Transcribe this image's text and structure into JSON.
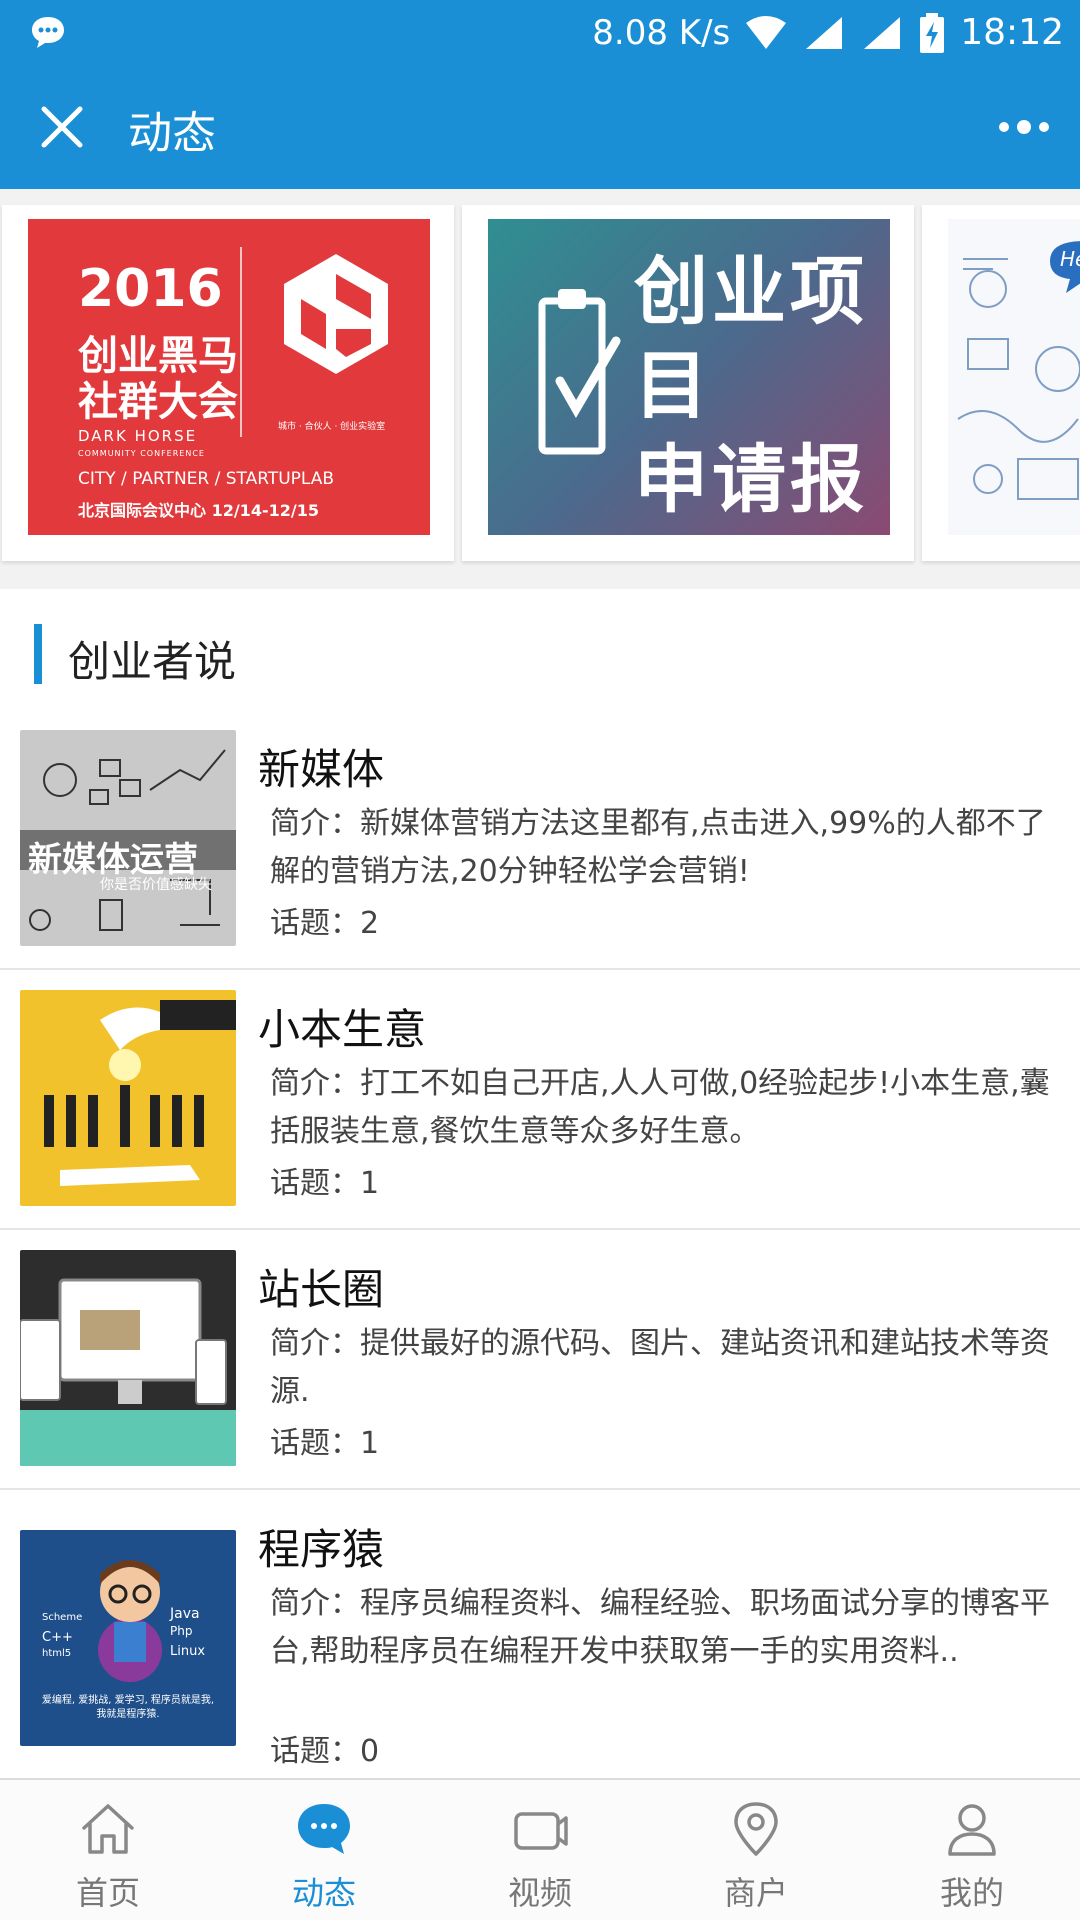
{
  "status_bar": {
    "speed": "8.08 K/s",
    "time": "18:12",
    "icons": [
      "chat-bubble-icon",
      "wifi-icon",
      "signal-icon",
      "signal-icon",
      "battery-charging-icon"
    ]
  },
  "app_bar": {
    "title": "动态",
    "close_icon": "close-icon",
    "more_icon": "more-icon"
  },
  "banners": [
    {
      "year": "2016",
      "line1": "创业黑马",
      "line2": "社群大会",
      "en": "DARK HORSE",
      "en_sub": "COMMUNITY CONFERENCE",
      "tagline": "CITY / PARTNER / STARTUPLAB",
      "venue": "北京国际会议中心  12/14-12/15",
      "logo_sub": "城市 · 合伙人 · 创业实验室"
    },
    {
      "text_line1": "创业项目",
      "text_line2": "申请报道"
    },
    {
      "help": "Help"
    }
  ],
  "section": {
    "title": "创业者说"
  },
  "items": [
    {
      "title": "新媒体",
      "intro": "简介：新媒体营销方法这里都有,点击进入,99%的人都不了解的营销方法,20分钟轻松学会营销!",
      "topics": "话题：2",
      "thumb_text": "新媒体运营",
      "thumb_sub": "你是否价值感缺失"
    },
    {
      "title": "小本生意",
      "intro": "简介：打工不如自己开店,人人可做,0经验起步!小本生意,囊括服装生意,餐饮生意等众多好生意。",
      "topics": "话题：1"
    },
    {
      "title": "站长圈",
      "intro": "简介：提供最好的源代码、图片、建站资讯和建站技术等资源.",
      "topics": "话题：1"
    },
    {
      "title": "程序猿",
      "intro": "简介：程序员编程资料、编程经验、职场面试分享的博客平台,帮助程序员在编程开发中获取第一手的实用资料..",
      "topics": "话题：0",
      "thumb_words": [
        "Scheme",
        "Java",
        "C++",
        "Php",
        "html5",
        "Linux"
      ],
      "thumb_caption": "爱编程, 爱挑战, 爱学习, 程序员就是我, 我就是程序猿."
    }
  ],
  "tabs": [
    {
      "label": "首页",
      "icon": "home-icon",
      "active": false
    },
    {
      "label": "动态",
      "icon": "chat-icon",
      "active": true
    },
    {
      "label": "视频",
      "icon": "video-icon",
      "active": false
    },
    {
      "label": "商户",
      "icon": "location-icon",
      "active": false
    },
    {
      "label": "我的",
      "icon": "user-icon",
      "active": false
    }
  ],
  "colors": {
    "primary": "#1a8fd6",
    "divider": "#e6e6e6"
  }
}
